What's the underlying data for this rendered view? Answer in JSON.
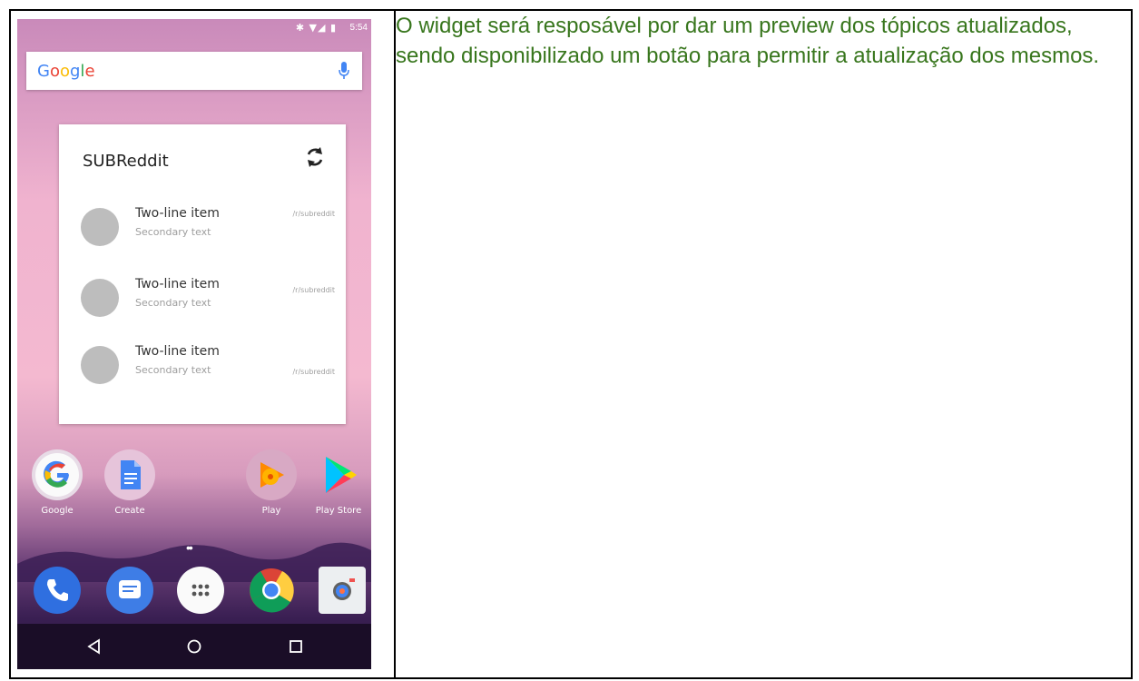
{
  "description": "O widget será resposável por dar um preview dos tópicos atualizados, sendo disponibilizado um botão para permitir a atualização dos mesmos.",
  "status_bar": {
    "icons": "✱ ▼◢ ▮",
    "time": "5:54"
  },
  "search": {
    "logo": "Google"
  },
  "widget": {
    "title": "SUBReddit",
    "items": [
      {
        "title": "Two-line item",
        "secondary": "Secondary text",
        "tag": "/r/subreddit"
      },
      {
        "title": "Two-line item",
        "secondary": "Secondary text",
        "tag": "/r/subreddit"
      },
      {
        "title": "Two-line item",
        "secondary": "Secondary text",
        "tag": "/r/subreddit"
      }
    ]
  },
  "apps": [
    {
      "label": "Google"
    },
    {
      "label": "Create"
    },
    {
      "label": "Play"
    },
    {
      "label": "Play Store"
    }
  ],
  "page_dots": "••",
  "colors": {
    "text_green": "#38761d",
    "google_blue": "#4285f4",
    "google_red": "#ea4335",
    "google_yellow": "#fbbc05",
    "google_green": "#34a853"
  }
}
